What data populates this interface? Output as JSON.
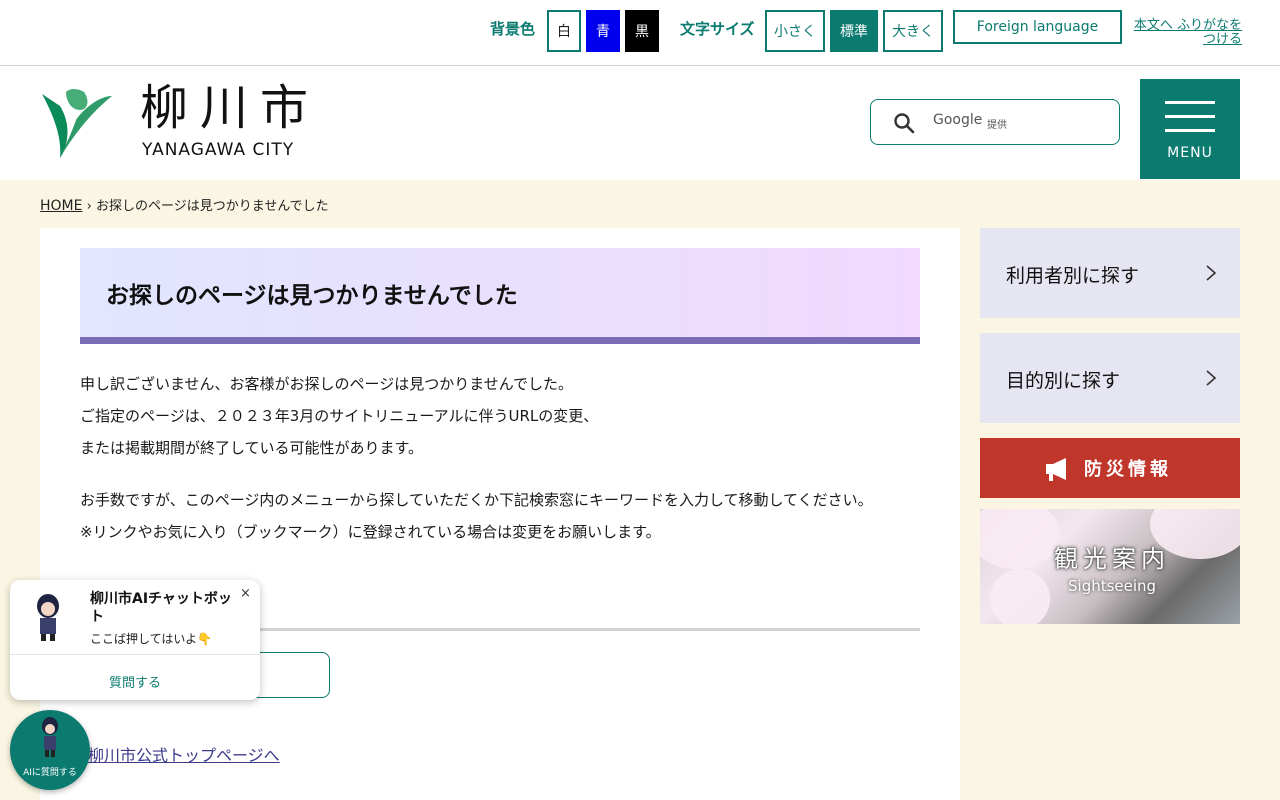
{
  "util": {
    "bg_label": "背景色",
    "bg_white": "白",
    "bg_blue": "青",
    "bg_black": "黒",
    "font_label": "文字サイズ",
    "font_small": "小さく",
    "font_standard": "標準",
    "font_large": "大きく",
    "foreign": "Foreign language",
    "furigana": "本文へ ふりがなをつける"
  },
  "header": {
    "logo_jp": "柳川市",
    "logo_en": "YANAGAWA CITY",
    "search_google": "Google",
    "search_provided": "提供",
    "menu_label": "MENU"
  },
  "breadcrumb": {
    "home": "HOME",
    "sep": "›",
    "current": "お探しのページは見つかりませんでした"
  },
  "main": {
    "title": "お探しのページは見つかりませんでした",
    "para1": [
      "申し訳ございません、お客様がお探しのページは見つかりませんでした。",
      "ご指定のページは、２０２３年3月のサイトリニューアルに伴うURLの変更、",
      "または掲載期間が終了している可能性があります。"
    ],
    "para2": [
      "お手数ですが、このページ内のメニューから探していただくか下記検索窓にキーワードを入力して移動してください。",
      "※リンクやお気に入り（ブックマーク）に登録されている場合は変更をお願いします。"
    ],
    "top_link": "柳川市公式トップページへ"
  },
  "sidebar": {
    "by_user": "利用者別に探す",
    "by_purpose": "目的別に探す",
    "disaster": "防災情報",
    "sightseeing_jp": "観光案内",
    "sightseeing_en": "Sightseeing"
  },
  "chatbot": {
    "title": "柳川市AIチャットボット",
    "subtitle": "ここば押してはいよ👇",
    "close": "×",
    "ask": "質問する",
    "fab_label": "AIに質問する"
  },
  "colors": {
    "brand": "#0b7a6f",
    "disaster": "#c1362a",
    "title_bar": "#7a6db6",
    "page_bg": "#faf6e3"
  }
}
